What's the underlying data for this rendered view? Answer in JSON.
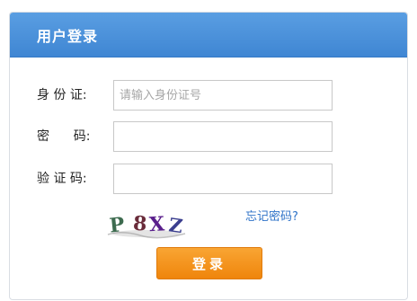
{
  "header": {
    "title": "用户登录"
  },
  "form": {
    "id_label": "身 份 证:",
    "id_placeholder": "请输入身份证号",
    "id_value": "",
    "password_label": "密      码:",
    "password_value": "",
    "captcha_label": "验 证 码:",
    "captcha_value": "",
    "captcha_chars": [
      "P",
      "8",
      "X",
      "Z"
    ],
    "forgot_link": "忘记密码?",
    "submit_label": "登录"
  },
  "colors": {
    "header_blue": "#4a90d9",
    "button_orange": "#f39019",
    "link_blue": "#2f73c8"
  }
}
